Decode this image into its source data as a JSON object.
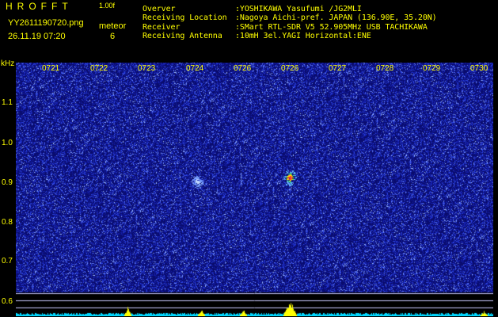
{
  "header": {
    "app_name": "HROFFT",
    "version": "1.00f",
    "filename": "YY2611190720.png",
    "datetime": "26.11.19 07:20",
    "meteor_label": "meteor",
    "meteor_count": "6",
    "info": [
      {
        "key": "Overver",
        "value": ":YOSHIKAWA Yasufumi /JG2MLI"
      },
      {
        "key": "Receiving Location",
        "value": ":Nagoya Aichi-pref. JAPAN (136.90E, 35.20N)"
      },
      {
        "key": "Receiver",
        "value": ":SMart RTL-SDR V5 52.905MHz USB TACHIKAWA"
      },
      {
        "key": "Receiving Antenna",
        "value": ":10mH 3el.YAGI Horizontal:ENE"
      }
    ]
  },
  "spectrogram": {
    "y_unit": "kHz",
    "y_ticks": [
      "1.1",
      "1.0",
      "0.9",
      "0.8",
      "0.7",
      "0.6"
    ],
    "x_ticks": [
      "0721",
      "0722",
      "0723",
      "0724",
      "0726",
      "0726",
      "0727",
      "0728",
      "0729",
      "0730"
    ],
    "colors": {
      "background": "#0a0c6e",
      "noise": "#3a52ff",
      "bright": "#8fb0ff",
      "level_bar": "#00d8ff",
      "peak": "#ffff00",
      "axis_text": "#ffff00",
      "line": "#c8c8ff"
    }
  },
  "chart_data": {
    "type": "heatmap",
    "xlabel": "",
    "ylabel": "kHz",
    "x_tick_labels": [
      "0721",
      "0722",
      "0723",
      "0724",
      "0726",
      "0726",
      "0727",
      "0728",
      "0729",
      "0730"
    ],
    "y_tick_labels": [
      "1.1",
      "1.0",
      "0.9",
      "0.8",
      "0.7",
      "0.6"
    ],
    "ylim": [
      0.59,
      1.2
    ],
    "xlim_minutes": [
      0,
      10
    ],
    "detections": [
      {
        "t_min": 3.6,
        "freq_khz": 0.895,
        "type": "echo",
        "intensity": 0.7
      },
      {
        "t_min": 4.55,
        "freq_khz": 0.9,
        "type": "trail",
        "intensity": 0.45
      },
      {
        "t_min": 5.6,
        "freq_khz": 0.905,
        "type": "echo",
        "intensity": 1.0
      }
    ],
    "level_peaks": [
      {
        "t_min": 2.1,
        "level": 0.55
      },
      {
        "t_min": 3.7,
        "level": 0.45
      },
      {
        "t_min": 4.6,
        "level": 0.4
      },
      {
        "t_min": 5.6,
        "level": 1.0
      },
      {
        "t_min": 9.8,
        "level": 0.3
      }
    ]
  }
}
